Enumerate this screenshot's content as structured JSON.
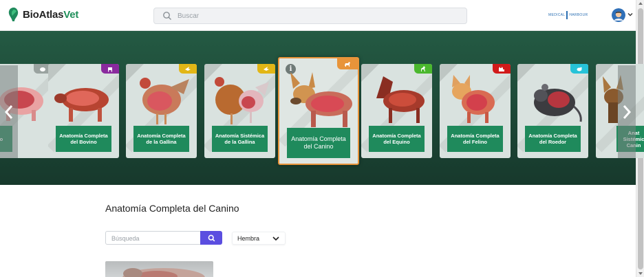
{
  "header": {
    "logo_prefix": "BioAtlas",
    "logo_suffix": "Vet",
    "search_placeholder": "Buscar",
    "partner_left": "MEDICAL",
    "partner_right": "HARBOUR"
  },
  "carousel": {
    "cards": [
      {
        "label": "...rcino",
        "badge_color": "#9aa3a0",
        "animal": "pig"
      },
      {
        "label": "Anatomía Completa del Bovino",
        "badge_color": "#8a2a9e",
        "animal": "cow"
      },
      {
        "label": "Anatomía Completa de la Gallina",
        "badge_color": "#e2b616",
        "animal": "hen"
      },
      {
        "label": "Anatomía Sistémica de la Gallina",
        "badge_color": "#e2b616",
        "animal": "hen"
      },
      {
        "label": "Anatomía Completa del Canino",
        "badge_color": "#e8943a",
        "animal": "dog",
        "active": true
      },
      {
        "label": "Anatomía Completa del Equino",
        "badge_color": "#4bb82e",
        "animal": "horse"
      },
      {
        "label": "Anatomía Completa del Felino",
        "badge_color": "#d11a1a",
        "animal": "cat"
      },
      {
        "label": "Anatomía Completa del Roedor",
        "badge_color": "#27c3d8",
        "animal": "rodent"
      },
      {
        "label": "Anatomía Sistémica del Canino",
        "badge_color": "#e8943a",
        "animal": "dog"
      }
    ],
    "partial_first_label": "rcino",
    "partial_last_label": "Anat\nSistémic\nCanin"
  },
  "content": {
    "title": "Anatomía Completa del Canino",
    "filter_placeholder": "Búsqueda",
    "sex_select_value": "Hembra"
  },
  "colors": {
    "brand_green": "#1f8a5c",
    "band_green": "#1c4736",
    "active_border": "#e8943a",
    "search_button": "#5b4ee0"
  }
}
